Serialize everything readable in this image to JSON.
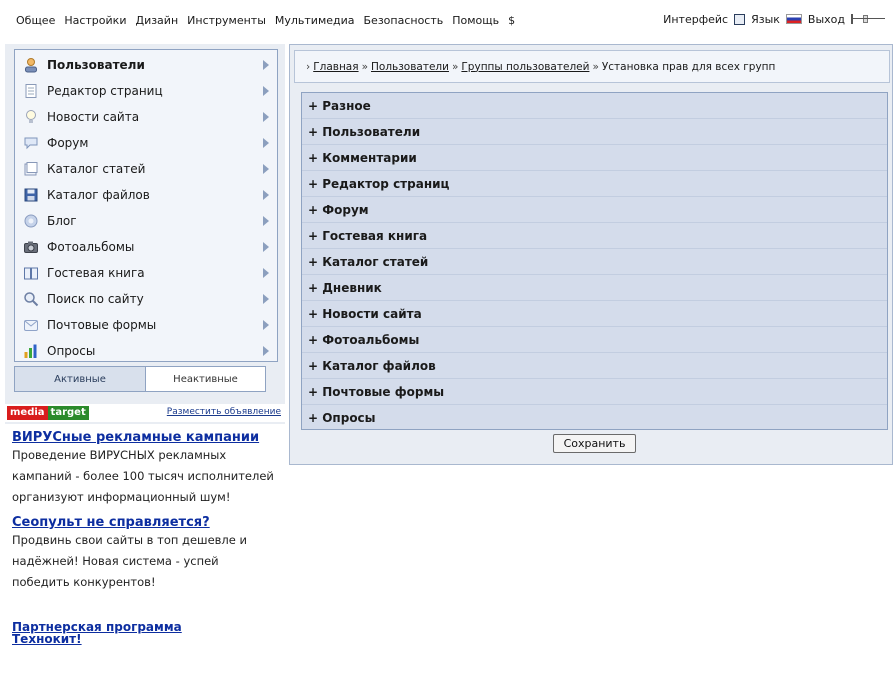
{
  "topbar": {
    "menu": [
      "Общее",
      "Настройки",
      "Дизайн",
      "Инструменты",
      "Мультимедиа",
      "Безопасность",
      "Помощь",
      "$"
    ],
    "interface_label": "Интерфейс",
    "language_label": "Язык",
    "exit_label": "Выход"
  },
  "sidebar": {
    "items": [
      {
        "label": "Пользователи",
        "icon": "user-icon"
      },
      {
        "label": "Редактор страниц",
        "icon": "page-icon"
      },
      {
        "label": "Новости сайта",
        "icon": "bulb-icon"
      },
      {
        "label": "Форум",
        "icon": "speech-bubble-icon"
      },
      {
        "label": "Каталог статей",
        "icon": "document-icon"
      },
      {
        "label": "Каталог файлов",
        "icon": "floppy-icon"
      },
      {
        "label": "Блог",
        "icon": "blog-icon"
      },
      {
        "label": "Фотоальбомы",
        "icon": "camera-icon"
      },
      {
        "label": "Гостевая книга",
        "icon": "book-icon"
      },
      {
        "label": "Поиск по сайту",
        "icon": "magnifier-icon"
      },
      {
        "label": "Почтовые формы",
        "icon": "mail-form-icon"
      },
      {
        "label": "Опросы",
        "icon": "bar-chart-icon"
      }
    ],
    "tabs": {
      "active": "Активные",
      "inactive": "Неактивные"
    }
  },
  "ads": {
    "logo_a": "media",
    "logo_b": "target",
    "place_link": "Разместить объявление",
    "items": [
      {
        "title": "ВИРУСные рекламные кампании",
        "text": "Проведение ВИРУСНЫХ рекламных кампаний - более 100 тысяч исполнителей организуют информационный шум!"
      },
      {
        "title": "Сеопульт не справляется?",
        "text": "Продвинь свои сайты в топ дешевле и надёжней! Новая система - успей победить конкурентов!"
      },
      {
        "title": "Партнерская программа Технокит!",
        "text": ""
      }
    ]
  },
  "breadcrumb": {
    "links": [
      "Главная",
      "Пользователи",
      "Группы пользователей"
    ],
    "current": "Установка прав для всех групп"
  },
  "groups": [
    "+ Разное",
    "+ Пользователи",
    "+ Комментарии",
    "+ Редактор страниц",
    "+ Форум",
    "+ Гостевая книга",
    "+ Каталог статей",
    "+ Дневник",
    "+ Новости сайта",
    "+ Фотоальбомы",
    "+ Каталог файлов",
    "+ Почтовые формы",
    "+ Опросы"
  ],
  "save_label": "Сохранить"
}
